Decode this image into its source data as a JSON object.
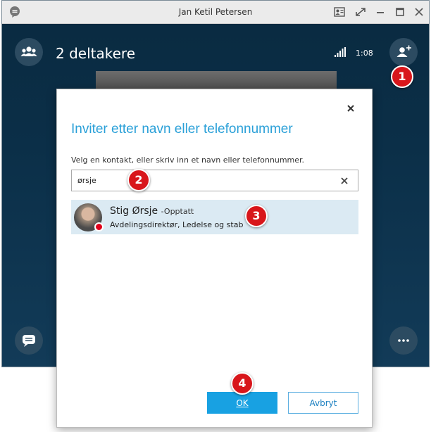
{
  "window": {
    "title": "Jan Ketil Petersen"
  },
  "call": {
    "participants_label": "2 deltakere",
    "duration": "1:08"
  },
  "dialog": {
    "title": "Inviter etter navn eller telefonnummer",
    "instruction": "Velg en kontakt, eller skriv inn et navn eller telefonnummer.",
    "search_value": "ørsje",
    "result": {
      "name": "Stig Ørsje",
      "status": "-Opptatt",
      "subtitle": "Avdelingsdirektør, Ledelse og stab",
      "presence_color": "#e0001b"
    },
    "ok_label": "OK",
    "cancel_label": "Avbryt"
  },
  "markers": [
    "1",
    "2",
    "3",
    "4"
  ],
  "icons": {
    "app": "chat-bubble-icon",
    "participants": "people-group-icon",
    "add_participant": "add-person-icon",
    "chat": "chat-bubble-icon",
    "more": "more-dots-icon",
    "close": "close-icon",
    "clear": "clear-icon"
  },
  "colors": {
    "accent": "#18a1e2",
    "marker": "#d8161b",
    "title_text": "#2aa0d8"
  }
}
